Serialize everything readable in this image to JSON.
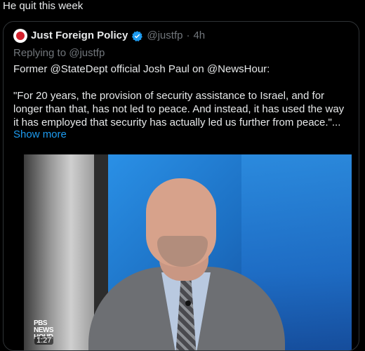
{
  "post": {
    "text": "He quit this week"
  },
  "quote": {
    "name": "Just Foreign Policy",
    "handle": "@justfp",
    "separator": "·",
    "time": "4h",
    "replying_prefix": "Replying to",
    "replying_to": "@justfp",
    "body_line1": "Former @StateDept official Josh Paul on @NewsHour:",
    "body_quote": "\"For 20 years, the provision of security assistance to Israel, and for longer than that, has not led to peace. And instead, it has used the way it has employed that security has actually led us further from peace.\"...",
    "show_more": "Show more"
  },
  "video": {
    "logo_text": "PBS NEWS HOUR",
    "timestamp": "1:27"
  },
  "icons": {
    "verified": "verified-badge-icon",
    "avatar": "just-foreign-policy-avatar"
  },
  "colors": {
    "background": "#000000",
    "text": "#e7e9ea",
    "muted": "#71767b",
    "link": "#1d9bf0",
    "verified": "#1d9bf0",
    "border": "#2f3336"
  }
}
